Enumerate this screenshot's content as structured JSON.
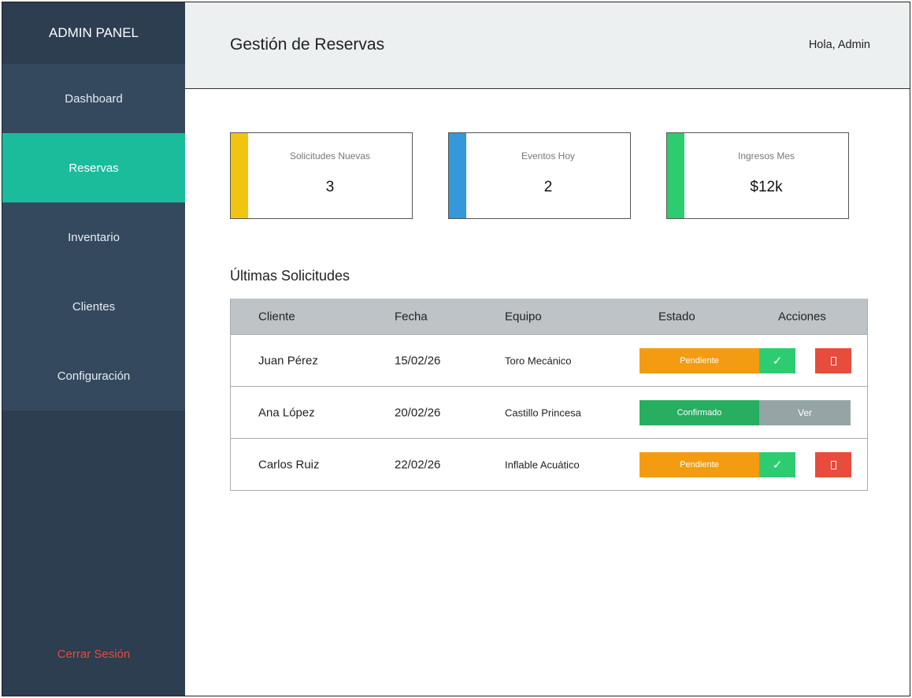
{
  "sidebar": {
    "brand": "ADMIN PANEL",
    "items": [
      {
        "label": "Dashboard"
      },
      {
        "label": "Reservas"
      },
      {
        "label": "Inventario"
      },
      {
        "label": "Clientes"
      },
      {
        "label": "Configuración"
      }
    ],
    "active_index": 1,
    "logout": "Cerrar Sesión"
  },
  "header": {
    "title": "Gestión de Reservas",
    "greeting": "Hola, Admin"
  },
  "stats": [
    {
      "label": "Solicitudes Nuevas",
      "value": "3",
      "color": "#f1c40f"
    },
    {
      "label": "Eventos Hoy",
      "value": "2",
      "color": "#3498db"
    },
    {
      "label": "Ingresos Mes",
      "value": "$12k",
      "color": "#2ecc71"
    }
  ],
  "requests": {
    "title": "Últimas Solicitudes",
    "columns": [
      "Cliente",
      "Fecha",
      "Equipo",
      "Estado",
      "Acciones"
    ],
    "rows": [
      {
        "cliente": "Juan Pérez",
        "fecha": "15/02/26",
        "equipo": "Toro Mecánico",
        "estado": "Pendiente"
      },
      {
        "cliente": "Ana López",
        "fecha": "20/02/26",
        "equipo": "Castillo Princesa",
        "estado": "Confirmado",
        "action": "Ver"
      },
      {
        "cliente": "Carlos Ruiz",
        "fecha": "22/02/26",
        "equipo": "Inflable Acuático",
        "estado": "Pendiente"
      }
    ]
  },
  "icons": {
    "approve": "check-icon",
    "reject": "delete-icon",
    "approve_glyph": "✓"
  },
  "colors": {
    "sidebar": "#2c3e50",
    "nav": "#34495e",
    "active": "#1abc9c",
    "pending": "#f39c12",
    "confirmed": "#27ae60",
    "approve": "#2ecc71",
    "reject": "#e74c3c",
    "view": "#95a5a6",
    "logout": "#e74c3c"
  }
}
